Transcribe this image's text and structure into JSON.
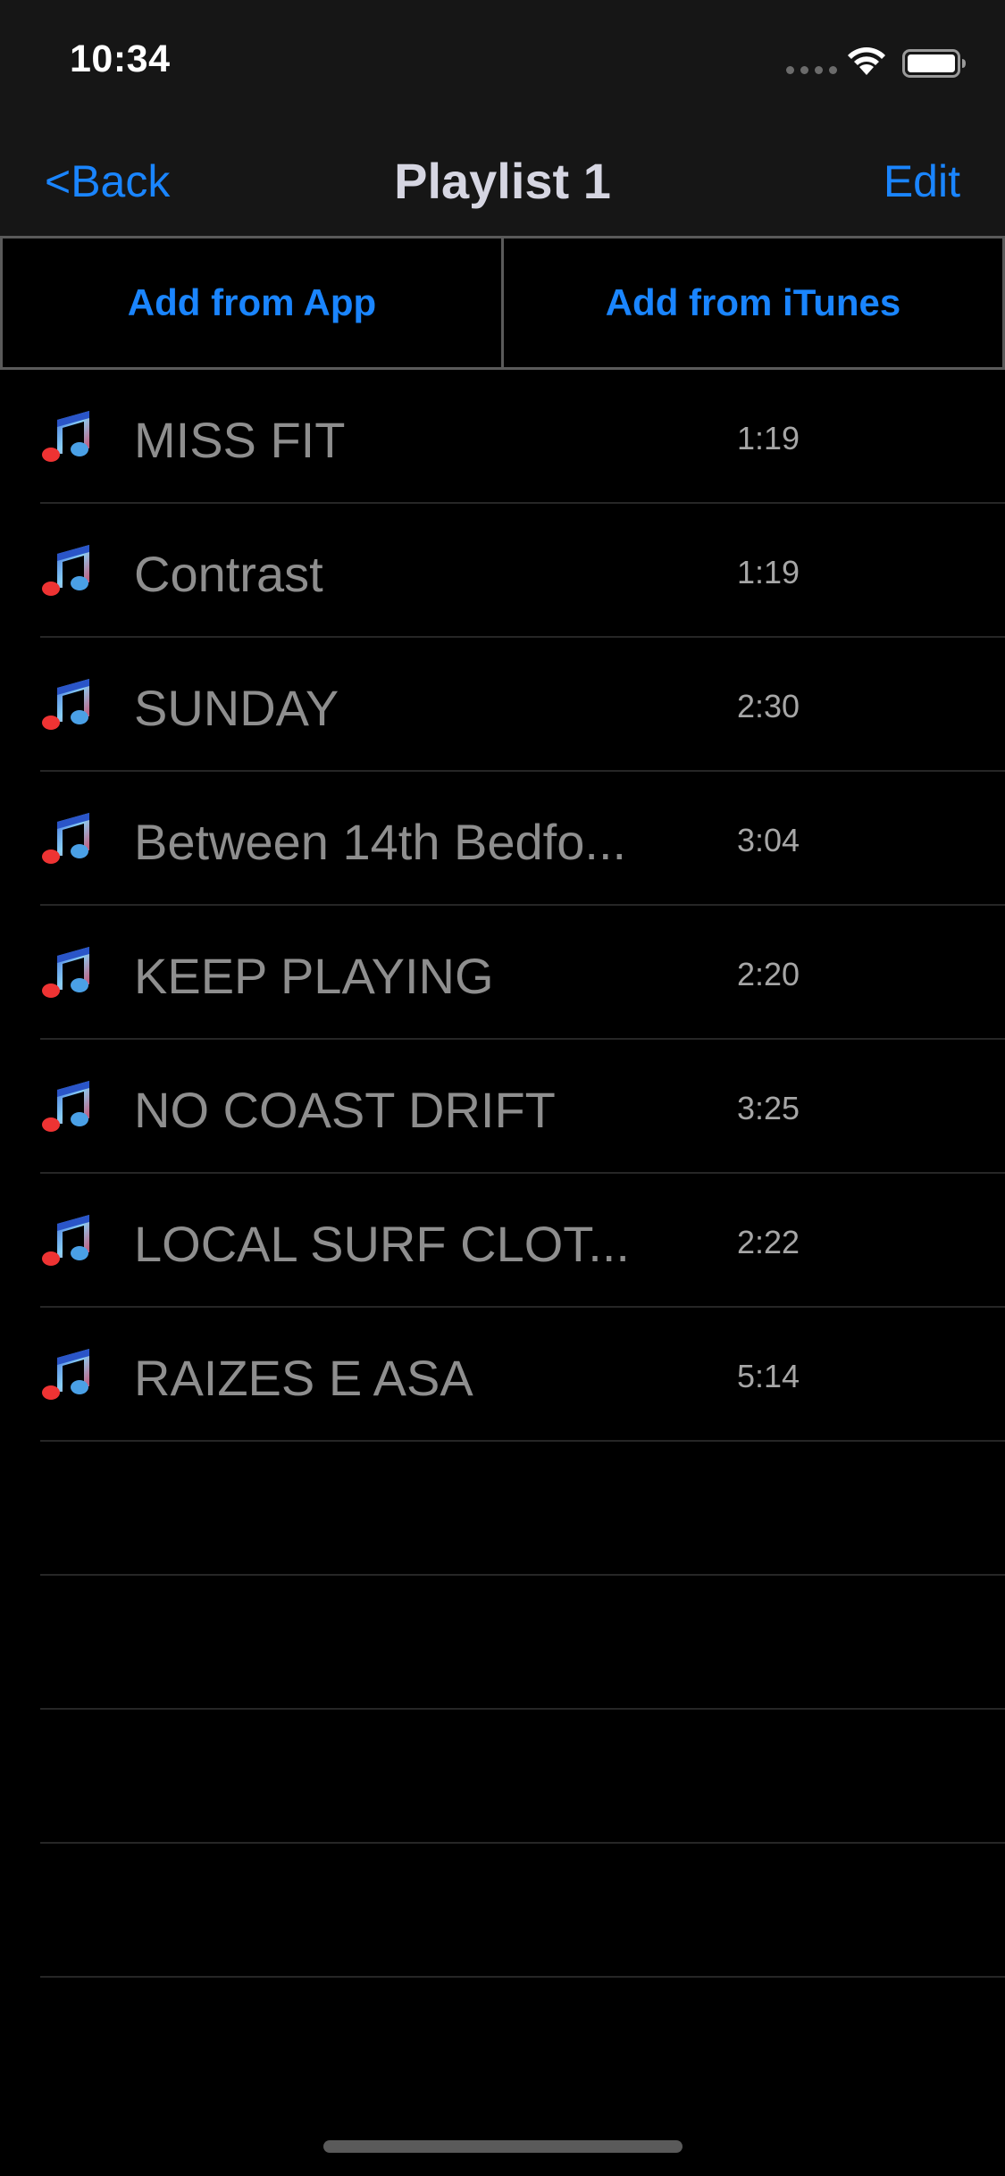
{
  "status_bar": {
    "time": "10:34"
  },
  "nav": {
    "back_label": "<Back",
    "title": "Playlist 1",
    "edit_label": "Edit"
  },
  "actions": {
    "add_from_app": "Add from App",
    "add_from_itunes": "Add from iTunes"
  },
  "tracks": [
    {
      "title": "MISS FIT",
      "duration": "1:19"
    },
    {
      "title": "Contrast",
      "duration": "1:19"
    },
    {
      "title": "SUNDAY",
      "duration": "2:30"
    },
    {
      "title": "Between 14th Bedfo...",
      "duration": "3:04"
    },
    {
      "title": "KEEP PLAYING",
      "duration": "2:20"
    },
    {
      "title": "NO COAST DRIFT",
      "duration": "3:25"
    },
    {
      "title": "LOCAL SURF CLOT...",
      "duration": "2:22"
    },
    {
      "title": "RAIZES E ASA",
      "duration": "5:14"
    }
  ],
  "icons": {
    "track": "music-note-icon",
    "wifi": "wifi-icon",
    "battery": "battery-icon"
  },
  "colors": {
    "accent": "#1a85ff",
    "background": "#000000",
    "bar": "#161616"
  }
}
